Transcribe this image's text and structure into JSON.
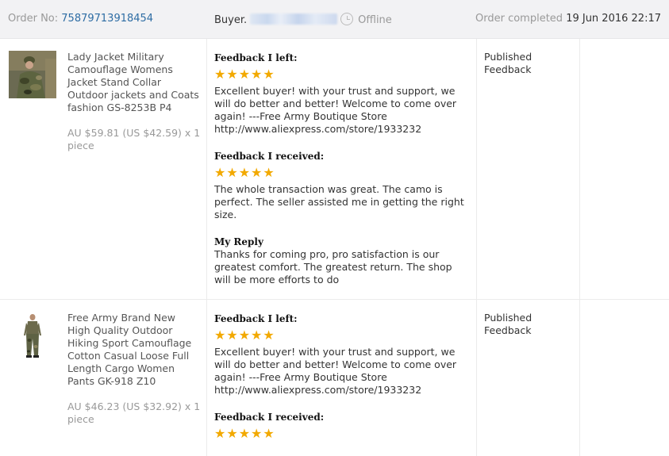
{
  "header": {
    "order_label": "Order No: ",
    "order_number": "75879713918454",
    "buyer_label": "Buyer.",
    "status": "Offline",
    "completed_label": "Order completed ",
    "completed_date": "19 Jun 2016 22:17"
  },
  "orders": [
    {
      "product_name": "Lady Jacket Military Camouflage Womens Jacket Stand Collar Outdoor jackets and Coats fashion GS-8253B P4",
      "price": "AU $59.81 (US $42.59) x 1 piece",
      "feedback_left_label": "Feedback I left:",
      "feedback_left_stars": "★★★★★",
      "feedback_left_text": "Excellent buyer! with your trust and support, we will do better and better! Welcome to come over again! ---Free Army Boutique Store http://www.aliexpress.com/store/1933232",
      "feedback_received_label": "Feedback I received:",
      "feedback_received_stars": "★★★★★",
      "feedback_received_text": "The whole transaction was great. The camo is perfect. The seller assisted me in getting the right size.",
      "reply_label": "My Reply",
      "reply_text": "Thanks for coming pro, pro satisfaction is our greatest comfort. The greatest return. The shop will be more efforts to do",
      "status": "Published Feedback"
    },
    {
      "product_name": "Free Army Brand New High Quality Outdoor Hiking Sport Camouflage Cotton Casual Loose Full Length Cargo Women Pants GK-918 Z10",
      "price": "AU $46.23 (US $32.92) x 1 piece",
      "feedback_left_label": "Feedback I left:",
      "feedback_left_stars": "★★★★★",
      "feedback_left_text": "Excellent buyer! with your trust and support, we will do better and better! Welcome to come over again! ---Free Army Boutique Store http://www.aliexpress.com/store/1933232",
      "feedback_received_label": "Feedback I received:",
      "feedback_received_stars": "★★★★★",
      "status": "Published Feedback"
    }
  ],
  "colors": {
    "star": "#f2a900",
    "link": "#2e6da4",
    "header_bg": "#f2f2f4"
  }
}
